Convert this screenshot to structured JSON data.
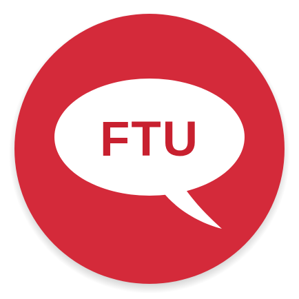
{
  "app_icon": {
    "icon": "speech-bubble-icon",
    "label": "FTU",
    "colors": {
      "background_circle": "#d42a3a",
      "bubble": "#ffffff",
      "label": "#c8202f",
      "shadow": "#b8b8b8"
    }
  }
}
